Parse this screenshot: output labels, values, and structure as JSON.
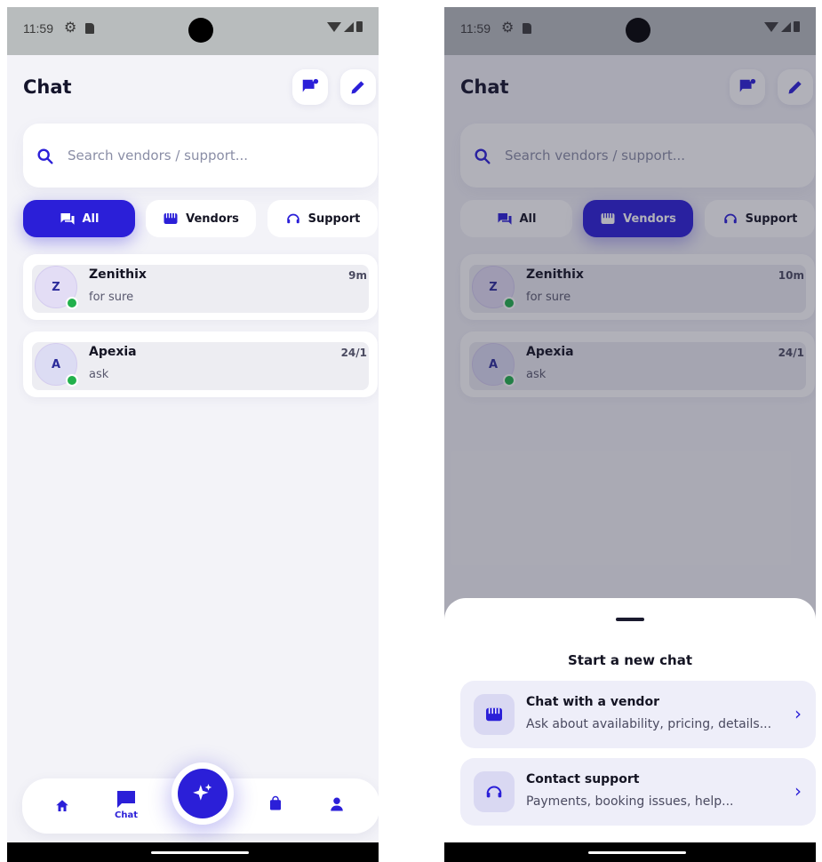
{
  "left": {
    "status_time": "11:59",
    "title": "Chat",
    "search_placeholder": "Search vendors / support...",
    "tabs": [
      {
        "label": "All",
        "icon": "chat-bubbles-icon",
        "active": true
      },
      {
        "label": "Vendors",
        "icon": "storefront-icon",
        "active": false
      },
      {
        "label": "Support",
        "icon": "headset-icon",
        "active": false
      }
    ],
    "conversations": [
      {
        "initial": "Z",
        "name": "Zenithix",
        "message": "for sure",
        "time": "9m",
        "online": true
      },
      {
        "initial": "A",
        "name": "Apexia",
        "message": "ask",
        "time": "24/1",
        "online": true
      }
    ],
    "nav": {
      "chat_label": "Chat"
    }
  },
  "right": {
    "status_time": "11:59",
    "title": "Chat",
    "search_placeholder": "Search vendors / support...",
    "tabs": [
      {
        "label": "All",
        "active": false
      },
      {
        "label": "Vendors",
        "active": true
      },
      {
        "label": "Support",
        "active": false
      }
    ],
    "conversations": [
      {
        "initial": "Z",
        "name": "Zenithix",
        "message": "for sure",
        "time": "10m"
      },
      {
        "initial": "A",
        "name": "Apexia",
        "message": "ask",
        "time": "24/1"
      }
    ],
    "sheet": {
      "title": "Start a new chat",
      "options": [
        {
          "title": "Chat with a vendor",
          "subtitle": "Ask about availability, pricing, details...",
          "icon": "storefront-icon"
        },
        {
          "title": "Contact support",
          "subtitle": "Payments, booking issues, help...",
          "icon": "headset-icon"
        }
      ]
    }
  },
  "colors": {
    "accent": "#2b1fd8",
    "online": "#22b14c",
    "background": "#f3f3f8"
  }
}
